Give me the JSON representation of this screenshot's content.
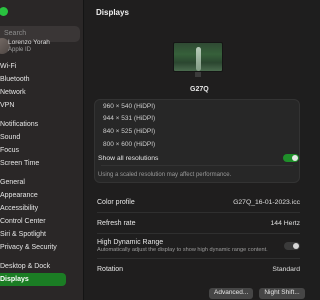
{
  "sidebar": {
    "search_placeholder": "Search",
    "account": {
      "name": "Lorenzo Yorah",
      "subtitle": "Apple ID"
    },
    "items": [
      {
        "label": "Wi-Fi"
      },
      {
        "label": "Bluetooth"
      },
      {
        "label": "Network"
      },
      {
        "label": "VPN"
      },
      {
        "label": "Notifications"
      },
      {
        "label": "Sound"
      },
      {
        "label": "Focus"
      },
      {
        "label": "Screen Time"
      },
      {
        "label": "General"
      },
      {
        "label": "Appearance"
      },
      {
        "label": "Accessibility"
      },
      {
        "label": "Control Center"
      },
      {
        "label": "Siri & Spotlight"
      },
      {
        "label": "Privacy & Security"
      },
      {
        "label": "Desktop & Dock"
      },
      {
        "label": "Displays"
      }
    ]
  },
  "main": {
    "title": "Displays",
    "display_name": "G27Q",
    "resolutions": [
      "960 × 540 (HiDPI)",
      "944 × 531 (HiDPI)",
      "840 × 525 (HiDPI)",
      "800 × 600 (HiDPI)"
    ],
    "show_all_label": "Show all resolutions",
    "show_all_on": true,
    "scaled_note": "Using a scaled resolution may affect performance.",
    "color_profile": {
      "label": "Color profile",
      "value": "G27Q_16-01-2023.icc"
    },
    "refresh_rate": {
      "label": "Refresh rate",
      "value": "144 Hertz"
    },
    "hdr": {
      "label": "High Dynamic Range",
      "subtitle": "Automatically adjust the display to show high dynamic range content.",
      "on": false
    },
    "rotation": {
      "label": "Rotation",
      "value": "Standard"
    },
    "buttons": {
      "advanced": "Advanced...",
      "night_shift": "Night Shift..."
    }
  },
  "colors": {
    "accent": "#1b7d24",
    "toggle_on": "#1f8f2a"
  }
}
